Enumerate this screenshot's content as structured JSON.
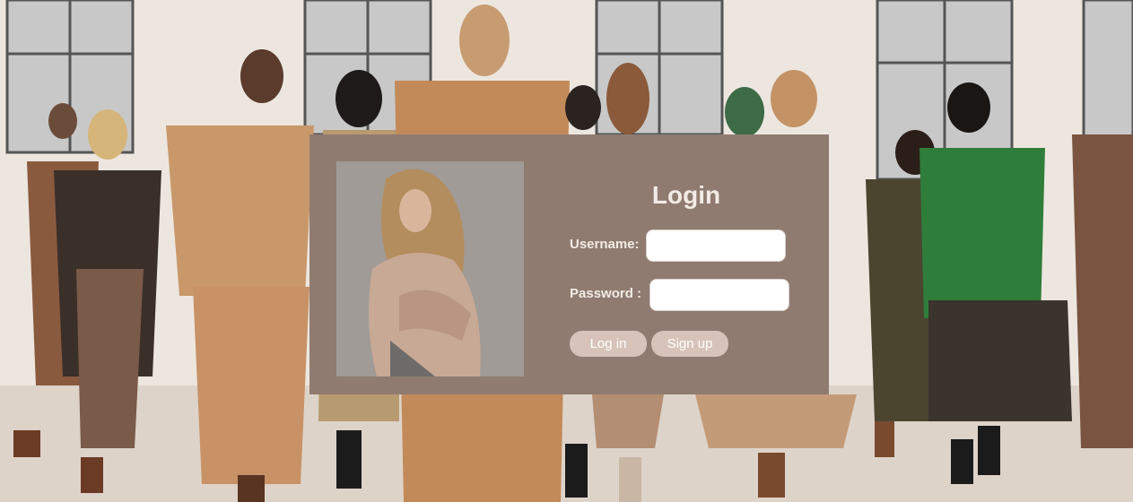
{
  "login": {
    "title": "Login",
    "username_label": "Username:",
    "password_label": "Password :",
    "username_value": "",
    "password_value": "",
    "login_button": "Log in",
    "signup_button": "Sign up"
  },
  "colors": {
    "panel": "#8f7b70",
    "button": "#d7c3b9",
    "text": "#f3ebe6"
  }
}
